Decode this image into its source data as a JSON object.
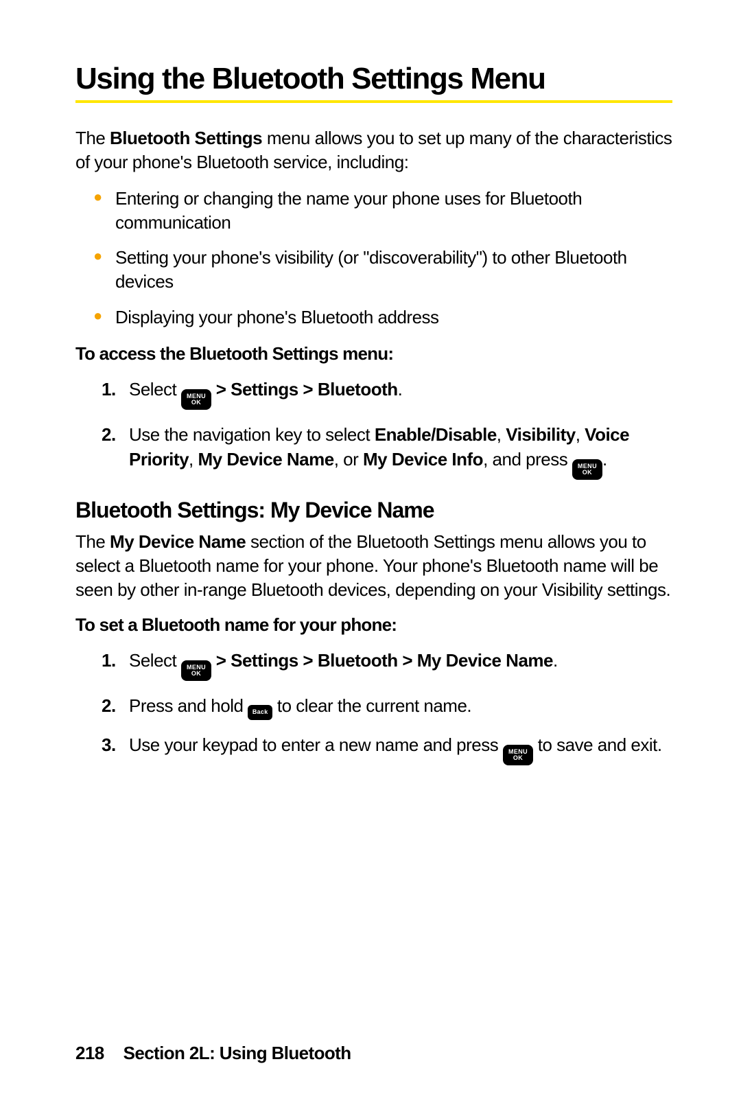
{
  "title": "Using the Bluetooth Settings Menu",
  "intro_pre": "The ",
  "intro_bold": "Bluetooth Settings",
  "intro_post": " menu allows you to set up many of the characteristics of your phone's Bluetooth service, including:",
  "bullets": [
    "Entering or changing the name your phone uses for Bluetooth communication",
    "Setting your phone's visibility (or \"discoverability\") to other Bluetooth devices",
    "Displaying your phone's Bluetooth address"
  ],
  "lead1": "To access the Bluetooth Settings menu:",
  "steps1": {
    "s1_pre": "Select ",
    "s1_path": " > Settings > Bluetooth",
    "s1_end": ".",
    "s2_pre": "Use the navigation key to select ",
    "s2_b1": "Enable/Disable",
    "s2_b2": "Visibility",
    "s2_b3": "Voice Priority",
    "s2_b4": "My Device Name",
    "s2_b5": "My Device Info",
    "s2_mid": ", and press ",
    "s2_end": "."
  },
  "h2": "Bluetooth Settings: My Device Name",
  "p2_pre": "The ",
  "p2_bold": "My Device Name",
  "p2_post": " section of the Bluetooth Settings menu allows you to select a Bluetooth name for your phone. Your phone's Bluetooth name will be seen by other in-range Bluetooth devices, depending on your Visibility settings.",
  "lead2": "To set a Bluetooth name for your phone:",
  "steps2": {
    "s1_pre": "Select ",
    "s1_path": " > Settings > Bluetooth > My Device Name",
    "s1_end": ".",
    "s2_pre": "Press and hold ",
    "s2_post": " to clear the current name.",
    "s3_pre": "Use your keypad to enter a new name and press ",
    "s3_post": " to save and exit."
  },
  "footer_page": "218",
  "footer_section": "Section 2L: Using Bluetooth",
  "key_menu_top": "MENU",
  "key_menu_bot": "OK",
  "key_back": "Back"
}
